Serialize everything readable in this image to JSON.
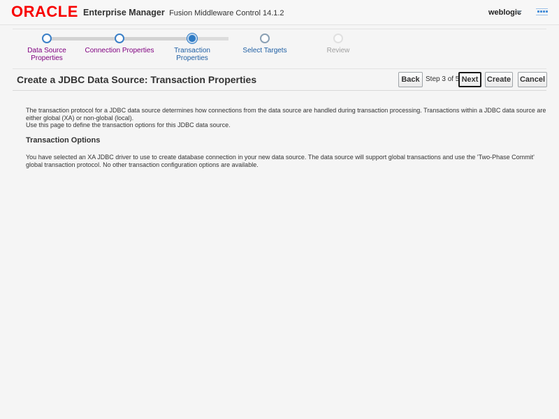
{
  "header": {
    "logo": "ORACLE",
    "product_bold": "Enterprise Manager",
    "product_sub": "Fusion Middleware Control 14.1.2",
    "user": "weblogic",
    "icons": {
      "caret": "chevron-down-icon",
      "menu": "menu-icon"
    }
  },
  "train": {
    "steps": [
      {
        "label": "Data Source Properties",
        "state": "visited"
      },
      {
        "label": "Connection Properties",
        "state": "visited"
      },
      {
        "label": "Transaction Properties",
        "state": "current"
      },
      {
        "label": "Select Targets",
        "state": "future"
      },
      {
        "label": "Review",
        "state": "disabled"
      }
    ]
  },
  "page": {
    "title": "Create a JDBC Data Source: Transaction Properties",
    "step_info": "Step 3 of 5",
    "buttons": {
      "back": "Back",
      "next": "Next",
      "create": "Create",
      "cancel": "Cancel"
    }
  },
  "content": {
    "intro_1": "The transaction protocol for a JDBC data source determines how connections from the data source are handled during transaction processing. Transactions within a JDBC data source are either global (XA) or non-global (local).",
    "intro_2": "Use this page to define the transaction options for this JDBC data source.",
    "section_title": "Transaction Options",
    "section_text": "You have selected an XA JDBC driver to use to create database connection in your new data source. The data source will support global transactions and use the 'Two-Phase Commit' global transaction protocol. No other transaction configuration options are available."
  },
  "colors": {
    "brand": "#f80000",
    "visited_label": "#800080",
    "active_label": "#1f5fa4",
    "current_node": "#2f7bc4"
  }
}
